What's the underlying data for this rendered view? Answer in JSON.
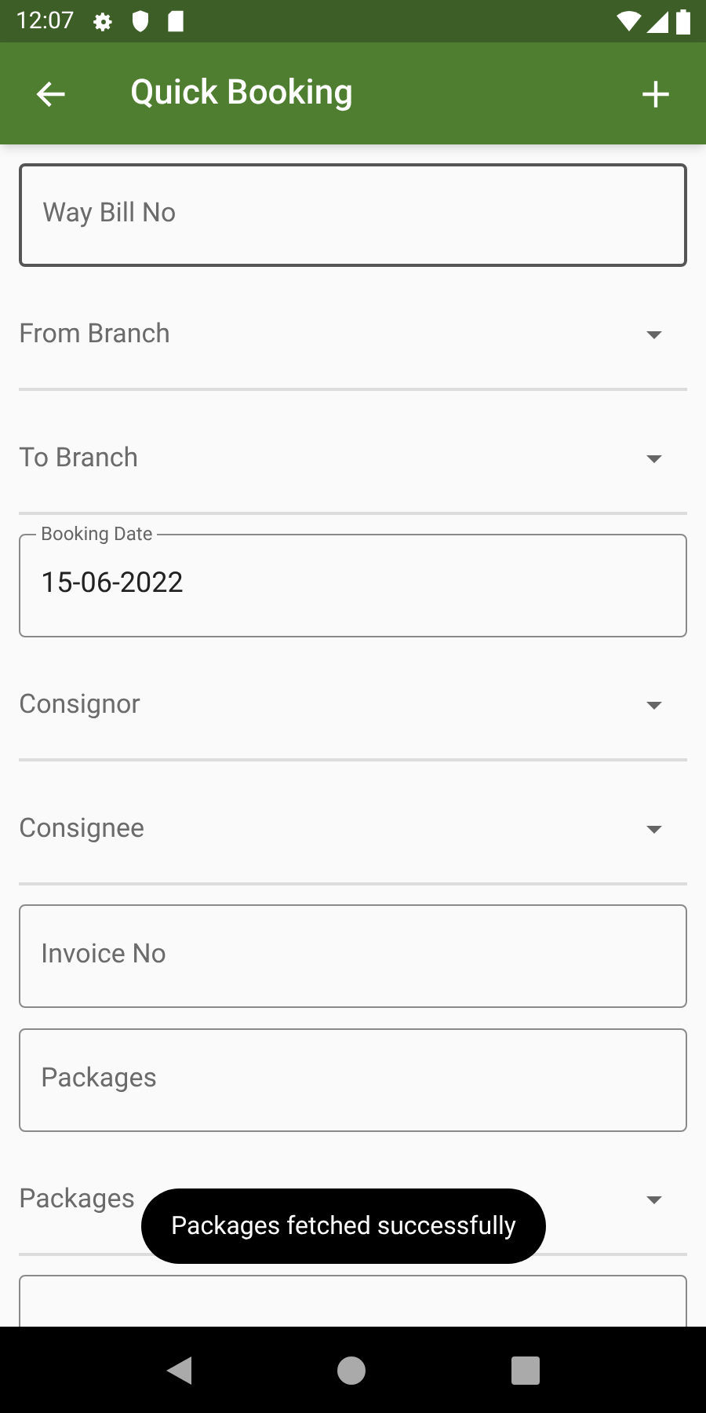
{
  "status_bar": {
    "time": "12:07"
  },
  "app_bar": {
    "title": "Quick Booking"
  },
  "fields": [
    {
      "kind": "outlined",
      "placeholder": "Way Bill No",
      "focused": true
    },
    {
      "kind": "dropdown",
      "label": "From Branch"
    },
    {
      "kind": "dropdown",
      "label": "To Branch"
    },
    {
      "kind": "outlined",
      "label": "Booking Date",
      "value": "15-06-2022",
      "focused": false
    },
    {
      "kind": "dropdown",
      "label": "Consignor"
    },
    {
      "kind": "dropdown",
      "label": "Consignee"
    },
    {
      "kind": "outlined",
      "placeholder": "Invoice No",
      "focused": false
    },
    {
      "kind": "outlined",
      "placeholder": "Packages",
      "focused": false
    },
    {
      "kind": "dropdown",
      "label": "Packages"
    },
    {
      "kind": "outlined",
      "focused": false
    }
  ],
  "toast": {
    "text": "Packages fetched successfully"
  }
}
